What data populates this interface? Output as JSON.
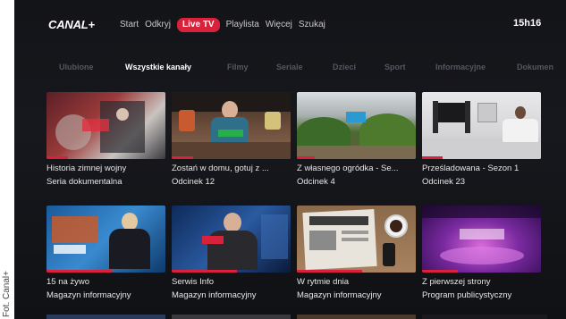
{
  "credit": "Fot. Canal+",
  "brand": {
    "logo": "CANAL+",
    "accent": "#d8223b"
  },
  "nav": {
    "items": [
      "Start",
      "Odkryj",
      "Live TV",
      "Playlista",
      "Więcej",
      "Szukaj"
    ],
    "active": "Live TV"
  },
  "clock": "15h16",
  "tabs": {
    "items": [
      "Ulubione",
      "Wszystkie kanały",
      "Filmy",
      "Seriale",
      "Dzieci",
      "Sport",
      "Informacyjne",
      "Dokumen"
    ],
    "selected": "Wszystkie kanały"
  },
  "tiles": [
    {
      "title": "Historia zimnej wojny",
      "subtitle": "Seria dokumentalna",
      "progress": 0.18,
      "thumbnail_icon": "rally-crowd-scene"
    },
    {
      "title": "Zostań w domu, gotuj z ...",
      "subtitle": "Odcinek 12",
      "progress": 0.18,
      "thumbnail_icon": "chef-kitchen-scene"
    },
    {
      "title": "Z własnego ogródka - Se...",
      "subtitle": "Odcinek 4",
      "progress": 0.15,
      "thumbnail_icon": "garden-scene"
    },
    {
      "title": "Prześladowana - Sezon 1",
      "subtitle": "Odcinek 23",
      "progress": 0.17,
      "thumbnail_icon": "living-room-scene"
    },
    {
      "title": "15 na żywo",
      "subtitle": "Magazyn informacyjny",
      "progress": 0.55,
      "thumbnail_icon": "news-anchor-scene"
    },
    {
      "title": "Serwis Info",
      "subtitle": "Magazyn informacyjny",
      "progress": 0.55,
      "thumbnail_icon": "news-presenter-scene"
    },
    {
      "title": "W rytmie dnia",
      "subtitle": "Magazyn informacyjny",
      "progress": 0.55,
      "thumbnail_icon": "newspaper-coffee-scene"
    },
    {
      "title": "Z pierwszej strony",
      "subtitle": "Program publicystyczny",
      "progress": 0.3,
      "thumbnail_icon": "purple-stage-scene"
    }
  ]
}
